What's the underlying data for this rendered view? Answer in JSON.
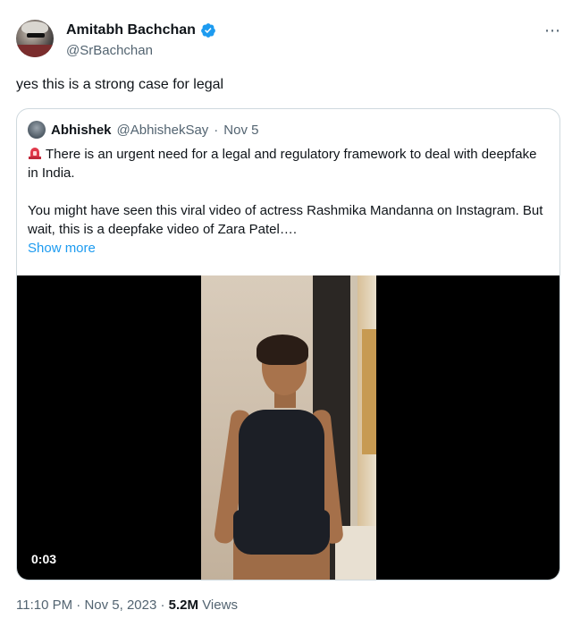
{
  "author": {
    "display_name": "Amitabh Bachchan",
    "handle": "@SrBachchan",
    "verified": true,
    "avatar_icon": "profile-photo"
  },
  "tweet": {
    "text": "yes this is a strong case for legal"
  },
  "more_icon": "⋯",
  "quoted_tweet": {
    "author_name": "Abhishek",
    "author_handle": "@AbhishekSay",
    "separator": "·",
    "date": "Nov 5",
    "line1_icon": "rotating-light-icon",
    "paragraph1": "There is an urgent need for a legal and regulatory framework to deal with deepfake in India.",
    "paragraph2": "You might have seen this viral video of actress Rashmika Mandanna on Instagram. But wait, this is a deepfake video of Zara Patel….",
    "show_more": "Show more",
    "video": {
      "duration": "0:03"
    }
  },
  "meta": {
    "time": "11:10 PM",
    "sep1": "·",
    "date": "Nov 5, 2023",
    "sep2": "·",
    "views_count": "5.2M",
    "views_label": "Views"
  },
  "colors": {
    "link": "#1d9bf0",
    "secondary_text": "#536471",
    "border": "#cfd9de"
  }
}
